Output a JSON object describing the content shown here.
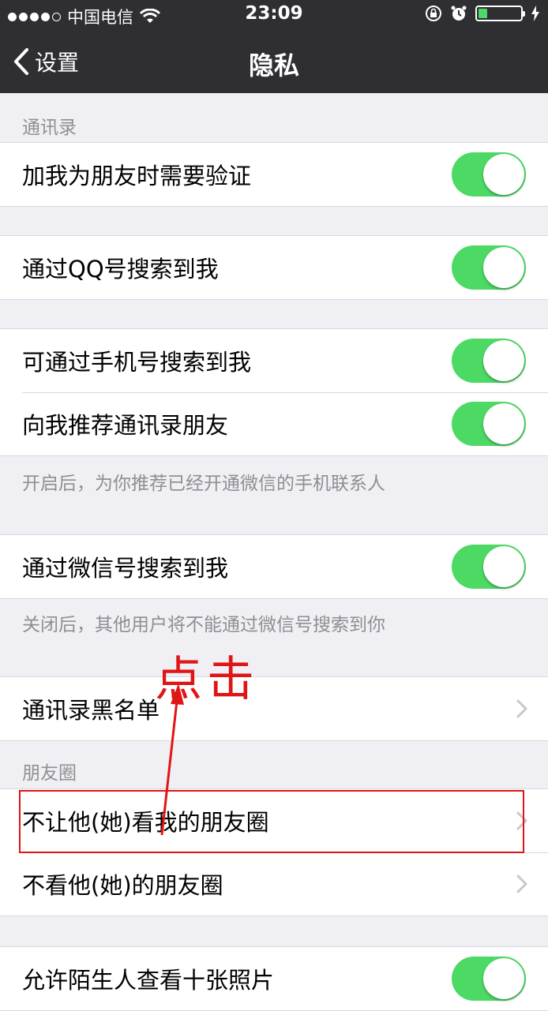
{
  "status_bar": {
    "carrier": "中国电信",
    "time": "23:09"
  },
  "nav": {
    "back_label": "设置",
    "title": "隐私"
  },
  "sections": {
    "contacts_label": "通讯录",
    "moments_label": "朋友圈"
  },
  "rows": {
    "verify": "加我为朋友时需要验证",
    "search_qq": "通过QQ号搜索到我",
    "search_phone": "可通过手机号搜索到我",
    "recommend": "向我推荐通讯录朋友",
    "search_wechat": "通过微信号搜索到我",
    "blacklist": "通讯录黑名单",
    "block_view": "不让他(她)看我的朋友圈",
    "hide_view": "不看他(她)的朋友圈",
    "partial": "允许陌生人查看十张照片"
  },
  "footnotes": {
    "recommend_note": "开启后，为你推荐已经开通微信的手机联系人",
    "wechat_note": "关闭后，其他用户将不能通过微信号搜索到你"
  },
  "annotation": {
    "click_text": "点击",
    "color": "#e01515"
  },
  "colors": {
    "nav_bg": "#2f2f33",
    "switch_on": "#4cd964",
    "background": "#efeff4"
  }
}
